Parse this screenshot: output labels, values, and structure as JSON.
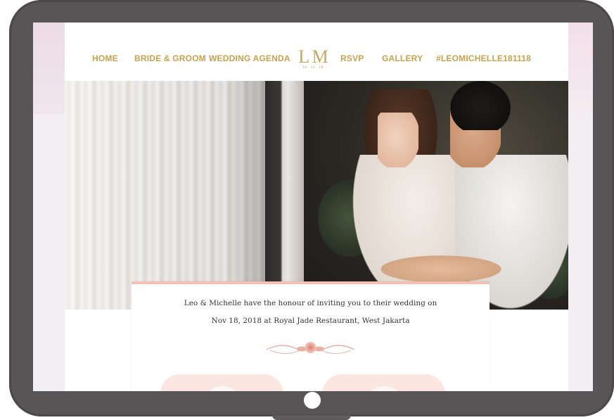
{
  "nav": {
    "home": "HOME",
    "bride_groom": "BRIDE & GROOM",
    "wedding_agenda": "WEDDING AGENDA",
    "rsvp": "RSVP",
    "gallery": "GALLERY",
    "hashtag": "#LEOMICHELLE181118"
  },
  "logo": {
    "monogram": "L M",
    "date": "18 . 11 . 18"
  },
  "invitation": {
    "line1": "Leo & Michelle have the honour of inviting you to their wedding on",
    "line2": "Nov 18, 2018 at Royal Jade Restaurant, West Jakarta"
  },
  "colors": {
    "accent_gold": "#c8a24e",
    "accent_pink": "#f0c2b6",
    "device_frame": "#575556"
  }
}
